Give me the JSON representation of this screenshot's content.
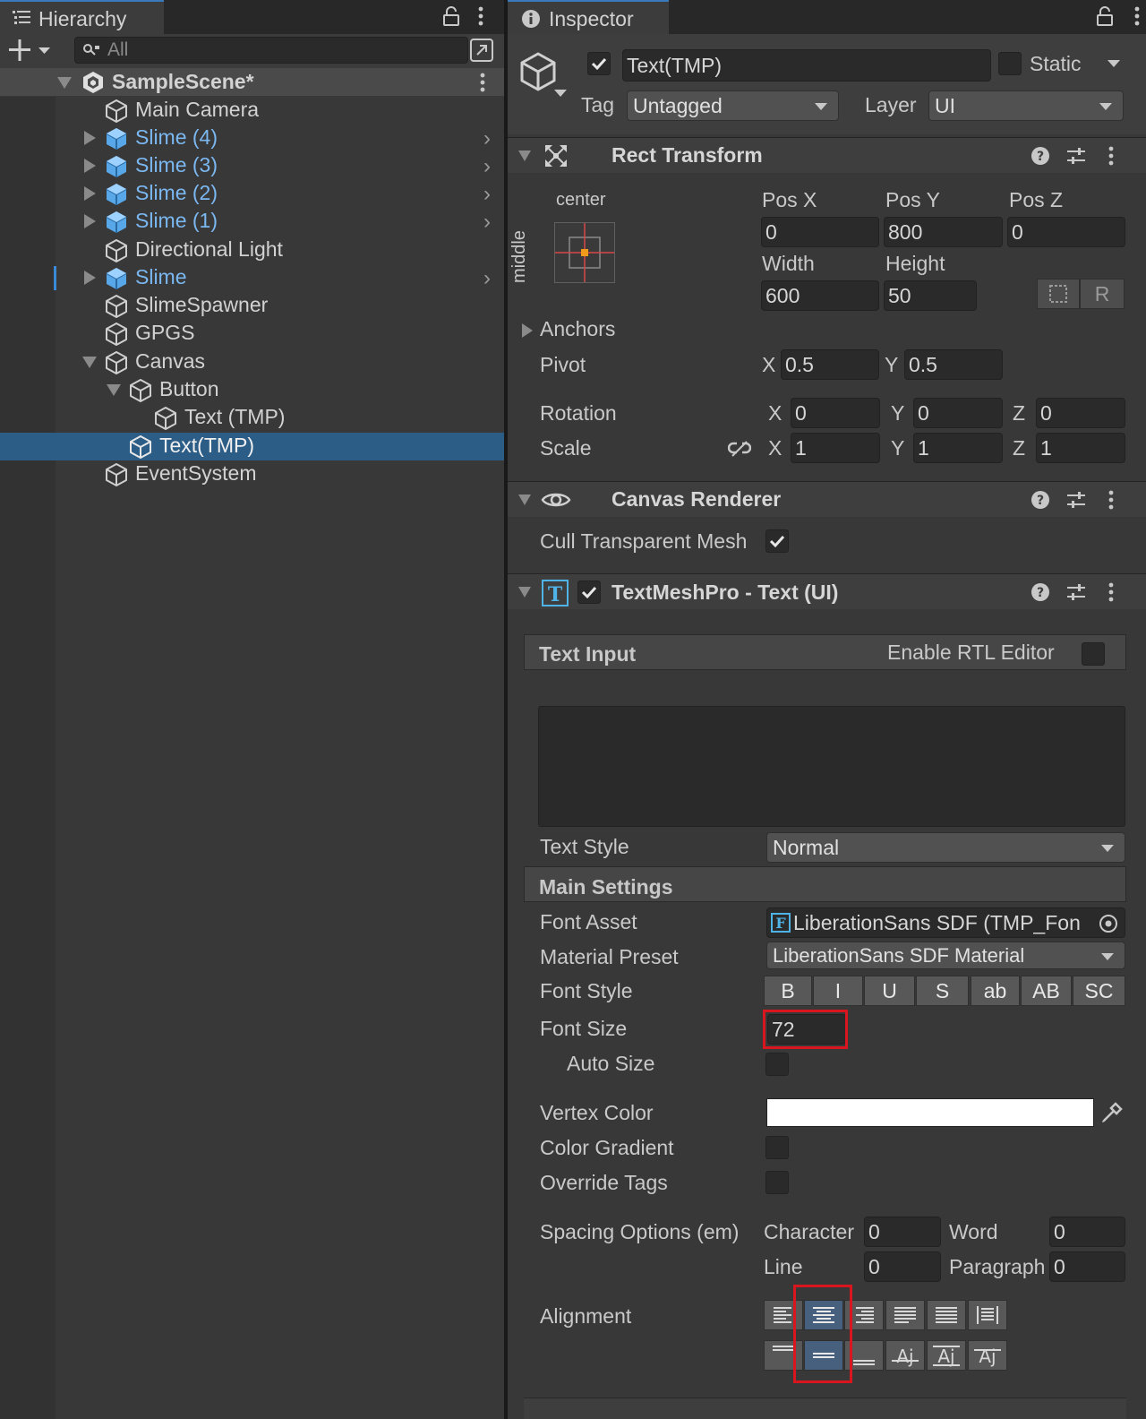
{
  "hierarchy": {
    "tab_label": "Hierarchy",
    "search_placeholder": "All",
    "scene_name": "SampleScene*",
    "items": [
      {
        "label": "Main Camera"
      },
      {
        "label": "Slime (4)"
      },
      {
        "label": "Slime (3)"
      },
      {
        "label": "Slime (2)"
      },
      {
        "label": "Slime (1)"
      },
      {
        "label": "Directional Light"
      },
      {
        "label": "Slime"
      },
      {
        "label": "SlimeSpawner"
      },
      {
        "label": "GPGS"
      },
      {
        "label": "Canvas"
      },
      {
        "label": "Button"
      },
      {
        "label": "Text (TMP)"
      },
      {
        "label": "Text(TMP)"
      },
      {
        "label": "EventSystem"
      }
    ]
  },
  "inspector": {
    "tab_label": "Inspector",
    "object_name": "Text(TMP)",
    "static_label": "Static",
    "tag_label": "Tag",
    "tag_value": "Untagged",
    "layer_label": "Layer",
    "layer_value": "UI",
    "rect_transform": {
      "title": "Rect Transform",
      "anchor_h": "center",
      "anchor_v": "middle",
      "pos_x_label": "Pos X",
      "pos_x": "0",
      "pos_y_label": "Pos Y",
      "pos_y": "800",
      "pos_z_label": "Pos Z",
      "pos_z": "0",
      "width_label": "Width",
      "width": "600",
      "height_label": "Height",
      "height": "50",
      "r_button": "R",
      "anchors_label": "Anchors",
      "pivot_label": "Pivot",
      "pivot_x": "0.5",
      "pivot_y": "0.5",
      "rotation_label": "Rotation",
      "rot_x": "0",
      "rot_y": "0",
      "rot_z": "0",
      "scale_label": "Scale",
      "scale_x": "1",
      "scale_y": "1",
      "scale_z": "1",
      "x": "X",
      "y": "Y",
      "z": "Z"
    },
    "canvas_renderer": {
      "title": "Canvas Renderer",
      "cull_label": "Cull Transparent Mesh"
    },
    "tmp": {
      "title": "TextMeshPro - Text (UI)",
      "text_input_label": "Text Input",
      "rtl_label": "Enable RTL Editor",
      "text_style_label": "Text Style",
      "text_style_value": "Normal",
      "main_settings_label": "Main Settings",
      "font_asset_label": "Font Asset",
      "font_asset_value": "LiberationSans SDF (TMP_Fon",
      "material_preset_label": "Material Preset",
      "material_preset_value": "LiberationSans SDF Material",
      "font_style_label": "Font Style",
      "font_style_buttons": [
        "B",
        "I",
        "U",
        "S",
        "ab",
        "AB",
        "SC"
      ],
      "font_size_label": "Font Size",
      "font_size_value": "72",
      "auto_size_label": "Auto Size",
      "vertex_color_label": "Vertex Color",
      "vertex_color": "#ffffff",
      "color_gradient_label": "Color Gradient",
      "override_tags_label": "Override Tags",
      "spacing_label": "Spacing Options (em)",
      "character_label": "Character",
      "character_value": "0",
      "word_label": "Word",
      "word_value": "0",
      "line_label": "Line",
      "line_value": "0",
      "paragraph_label": "Paragraph",
      "paragraph_value": "0",
      "alignment_label": "Alignment"
    }
  },
  "colors": {
    "selection": "#2c5d87",
    "prefab_text": "#7bb7f0",
    "highlight_box": "#d9151d",
    "active_align": "#46607e"
  }
}
